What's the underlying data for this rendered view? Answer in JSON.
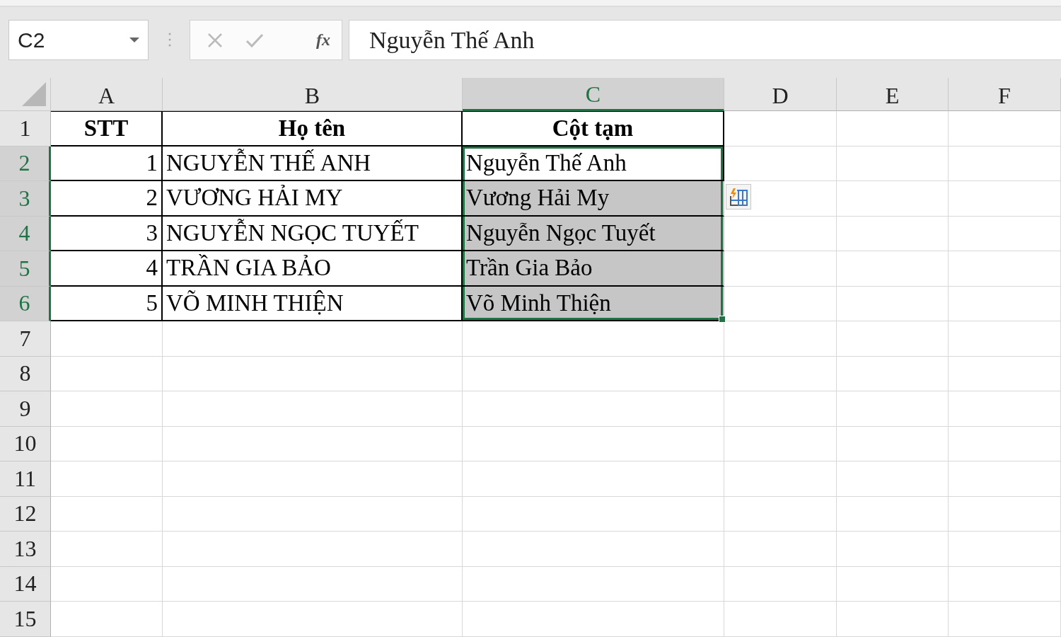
{
  "name_box": {
    "value": "C2"
  },
  "insert_function": {
    "label": "fx"
  },
  "formula_bar": {
    "value": "Nguyễn Thế Anh"
  },
  "columns": [
    {
      "label": "A",
      "selected": false
    },
    {
      "label": "B",
      "selected": false
    },
    {
      "label": "C",
      "selected": true
    },
    {
      "label": "D",
      "selected": false
    },
    {
      "label": "E",
      "selected": false
    },
    {
      "label": "F",
      "selected": false
    }
  ],
  "rows": [
    {
      "number": "1",
      "selected": false,
      "cells": [
        {
          "kind": "header",
          "text": "STT",
          "selected": false
        },
        {
          "kind": "header",
          "text": "Họ tên",
          "selected": false
        },
        {
          "kind": "header",
          "text": "Cột tạm",
          "selected": false
        }
      ]
    },
    {
      "number": "2",
      "selected": true,
      "cells": [
        {
          "kind": "number",
          "text": "1",
          "selected": false
        },
        {
          "kind": "text",
          "text": "NGUYỄN THẾ ANH",
          "selected": false
        },
        {
          "kind": "text",
          "text": "Nguyễn Thế Anh",
          "selected": true,
          "active": true
        }
      ]
    },
    {
      "number": "3",
      "selected": true,
      "cells": [
        {
          "kind": "number",
          "text": "2",
          "selected": false
        },
        {
          "kind": "text",
          "text": "VƯƠNG HẢI MY",
          "selected": false
        },
        {
          "kind": "text",
          "text": "Vương Hải My",
          "selected": true,
          "active": false
        }
      ]
    },
    {
      "number": "4",
      "selected": true,
      "cells": [
        {
          "kind": "number",
          "text": "3",
          "selected": false
        },
        {
          "kind": "text",
          "text": "NGUYỄN NGỌC TUYẾT",
          "selected": false
        },
        {
          "kind": "text",
          "text": "Nguyễn Ngọc Tuyết",
          "selected": true,
          "active": false
        }
      ]
    },
    {
      "number": "5",
      "selected": true,
      "cells": [
        {
          "kind": "number",
          "text": "4",
          "selected": false
        },
        {
          "kind": "text",
          "text": "TRẦN GIA BẢO",
          "selected": false
        },
        {
          "kind": "text",
          "text": "Trần Gia Bảo",
          "selected": true,
          "active": false
        }
      ]
    },
    {
      "number": "6",
      "selected": true,
      "cells": [
        {
          "kind": "number",
          "text": "5",
          "selected": false
        },
        {
          "kind": "text",
          "text": "VÕ MINH THIỆN",
          "selected": false
        },
        {
          "kind": "text",
          "text": "Võ Minh Thiện",
          "selected": true,
          "active": false
        }
      ]
    },
    {
      "number": "7",
      "selected": false
    },
    {
      "number": "8",
      "selected": false
    },
    {
      "number": "9",
      "selected": false
    },
    {
      "number": "10",
      "selected": false
    },
    {
      "number": "11",
      "selected": false
    },
    {
      "number": "12",
      "selected": false
    },
    {
      "number": "13",
      "selected": false
    },
    {
      "number": "14",
      "selected": false
    },
    {
      "number": "15",
      "selected": false
    }
  ],
  "flash_fill_options": {
    "visible": true
  }
}
